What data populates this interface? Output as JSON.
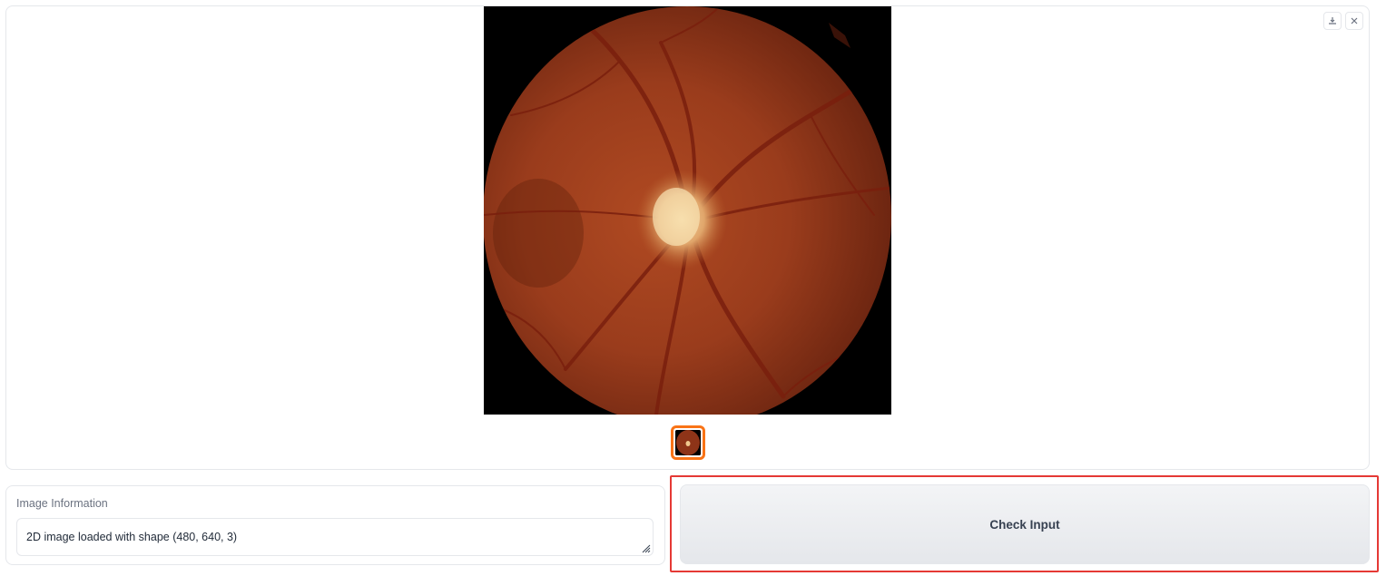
{
  "gallery": {
    "download_icon": "download-icon",
    "close_icon": "close-icon",
    "selected_thumbnail": 1
  },
  "info": {
    "label": "Image Information",
    "value": "2D image loaded with shape (480, 640, 3)"
  },
  "actions": {
    "check_label": "Check Input"
  },
  "colors": {
    "accent": "#f97316",
    "highlight": "#e53935",
    "button_bg": "#e5e7eb"
  }
}
